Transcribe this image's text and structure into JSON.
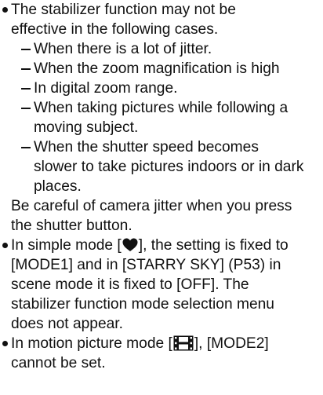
{
  "content": {
    "p1": {
      "line1": "The stabilizer function may not be",
      "line2": "effective in the following cases."
    },
    "cases": [
      {
        "line1": "When there is a lot of jitter."
      },
      {
        "line1": "When the zoom magnification is high"
      },
      {
        "line1": "In digital zoom range."
      },
      {
        "line1": "When taking pictures while following a",
        "line2": "moving subject."
      },
      {
        "line1": "When the shutter speed becomes",
        "line2": "slower to take pictures indoors or in dark",
        "line3": "places."
      }
    ],
    "note": {
      "line1": "Be careful of camera jitter when you press",
      "line2": "the shutter button."
    },
    "p2": {
      "line1_before": "In simple mode [",
      "line1_after": "], the setting is fixed to",
      "line2": "[MODE1] and in [STARRY SKY] (P53) in",
      "line3": "scene mode it is fixed to [OFF]. The",
      "line4": "stabilizer function mode selection menu",
      "line5": "does not appear."
    },
    "p3": {
      "line1_before": "In motion picture mode [",
      "line1_after": "], [MODE2]",
      "line2": "cannot be set."
    },
    "icons": {
      "simple_mode": "heart-icon",
      "motion_picture": "film-icon"
    }
  }
}
